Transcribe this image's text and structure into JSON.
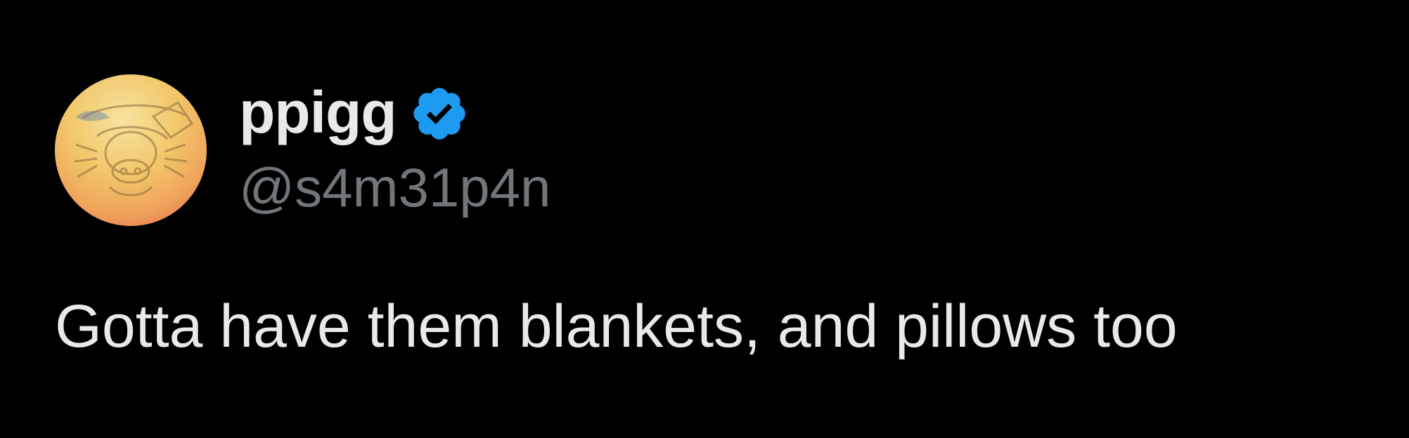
{
  "tweet": {
    "author": {
      "display_name": "ppigg",
      "handle": "@s4m31p4n",
      "verified": true,
      "avatar_icon": "pig-drawing-avatar"
    },
    "text": "Gotta have them blankets, and pillows too"
  },
  "colors": {
    "background": "#000000",
    "primary_text": "#e7e9ea",
    "secondary_text": "#71767b",
    "verified_blue": "#1d9bf0"
  }
}
